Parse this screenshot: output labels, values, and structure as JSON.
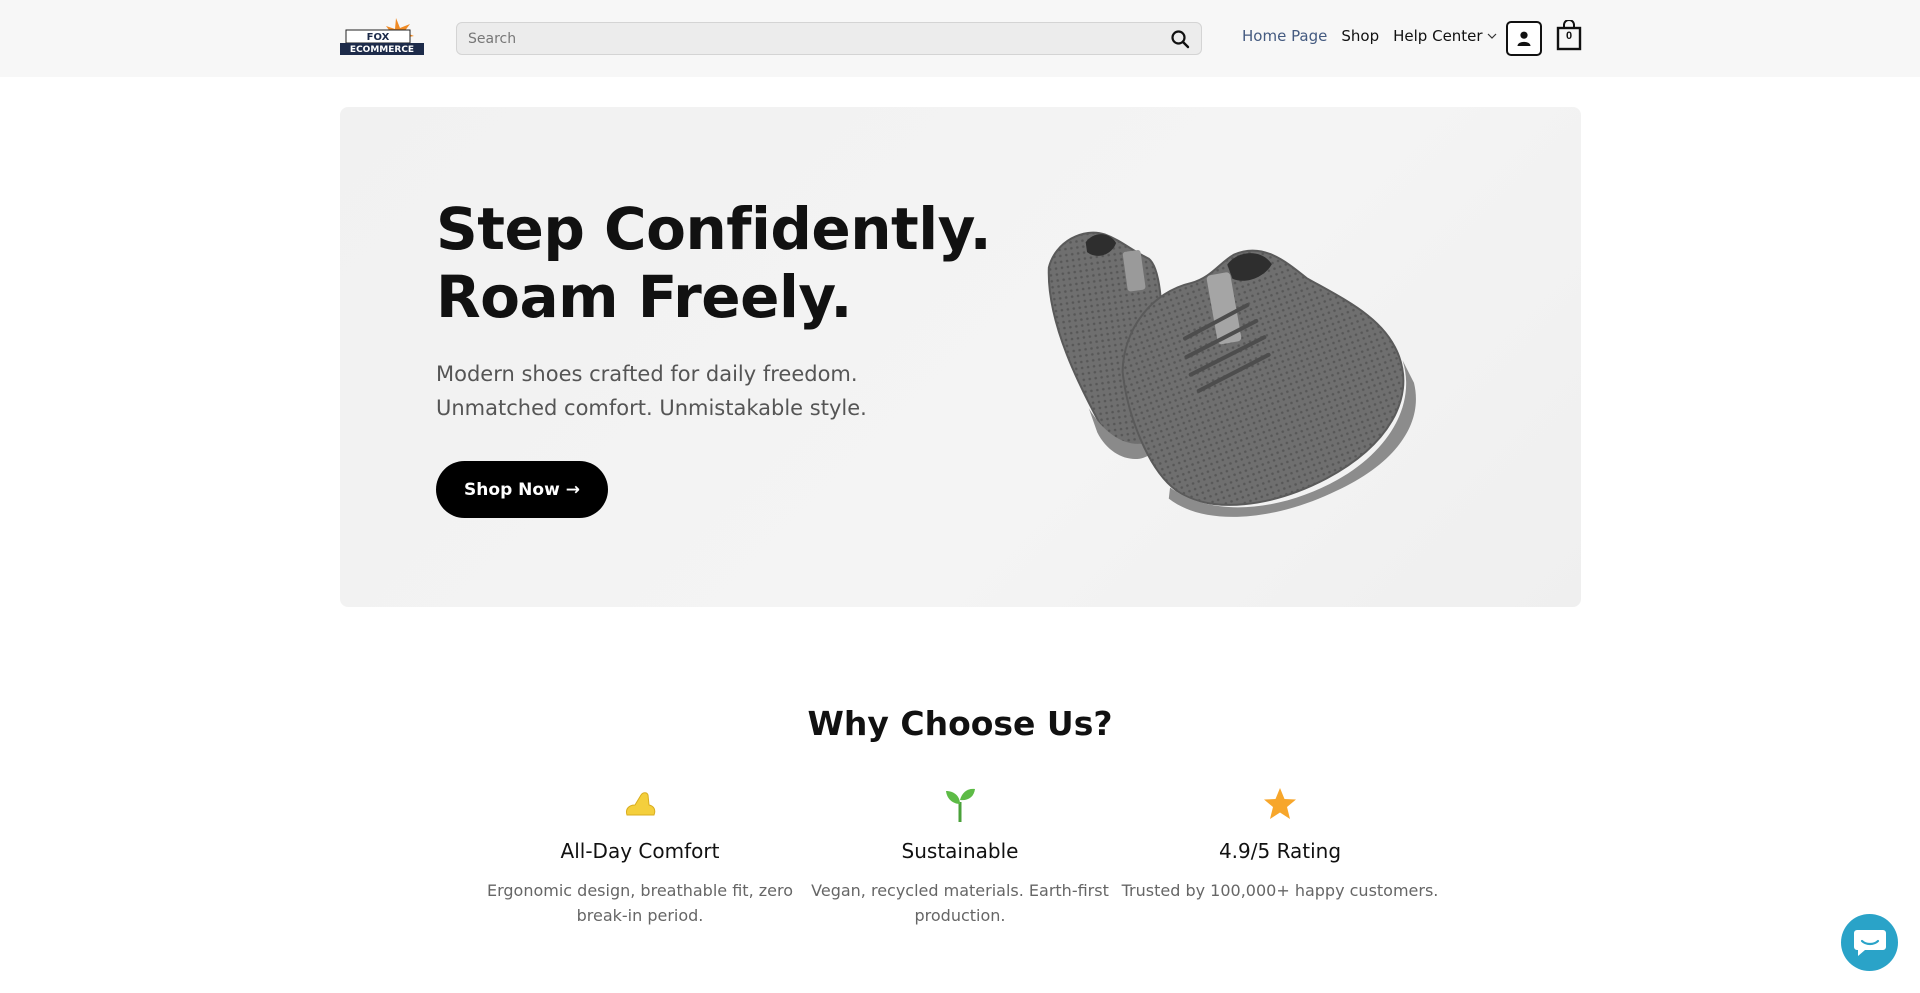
{
  "header": {
    "search": {
      "placeholder": "Search"
    },
    "nav": {
      "home": "Home Page",
      "shop": "Shop",
      "help": "Help Center"
    },
    "cart_count": "0"
  },
  "hero": {
    "title_line1": "Step Confidently.",
    "title_line2": "Roam Freely.",
    "sub_line1": "Modern shoes crafted for daily freedom.",
    "sub_line2": "Unmatched comfort. Unmistakable style.",
    "cta": "Shop Now →"
  },
  "why": {
    "title": "Why Choose Us?",
    "features": [
      {
        "icon": "foot-icon",
        "title": "All-Day Comfort",
        "desc": "Ergonomic design, breathable fit, zero break-in period."
      },
      {
        "icon": "seedling-icon",
        "title": "Sustainable",
        "desc": "Vegan, recycled materials. Earth-first production."
      },
      {
        "icon": "star-icon",
        "title": "4.9/5 Rating",
        "desc": "Trusted by 100,000+ happy customers."
      }
    ]
  },
  "colors": {
    "accent_nav": "#445a80",
    "chat": "#2aa3c8",
    "cta": "#000000"
  }
}
